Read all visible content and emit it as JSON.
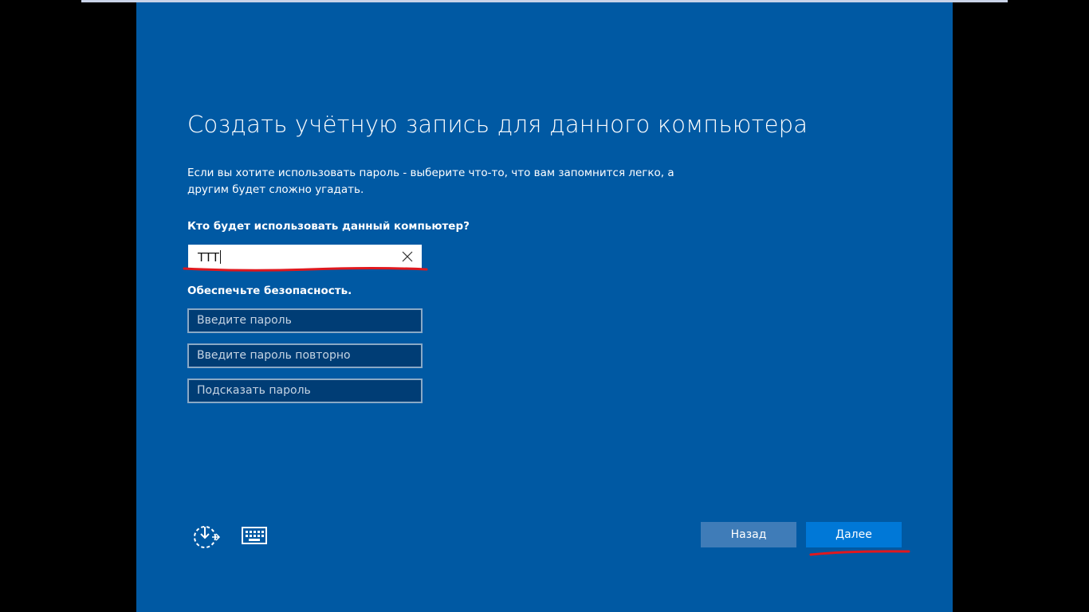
{
  "page": {
    "title": "Создать учётную запись для данного компьютера",
    "description": "Если вы хотите использовать пароль - выберите что-то, что вам запомнится легко, а другим будет сложно угадать.",
    "who_label": "Кто будет использовать данный компьютер?",
    "username_value": "TTT",
    "security_label": "Обеспечьте безопасность.",
    "password_placeholder": "Введите пароль",
    "password_confirm_placeholder": "Введите пароль повторно",
    "hint_placeholder": "Подсказать пароль"
  },
  "buttons": {
    "back_label": "Назад",
    "next_label": "Далее"
  },
  "icons": {
    "ease_of_access": "ease-of-access-icon",
    "keyboard": "keyboard-icon",
    "clear": "close-icon"
  },
  "colors": {
    "background": "#0059a3",
    "next_button": "#0078d7",
    "back_button": "#3f7cb8",
    "annotation": "#e0181e"
  }
}
